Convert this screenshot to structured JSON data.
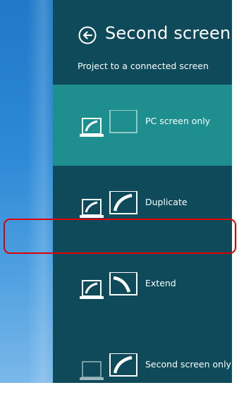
{
  "panel": {
    "title": "Second screen",
    "subtitle": "Project to a connected screen"
  },
  "options": [
    {
      "label": "PC screen only",
      "selected": true,
      "icon": "pc-screen-only-icon"
    },
    {
      "label": "Duplicate",
      "selected": false,
      "icon": "duplicate-icon"
    },
    {
      "label": "Extend",
      "selected": false,
      "icon": "extend-icon"
    },
    {
      "label": "Second screen only",
      "selected": false,
      "icon": "second-screen-only-icon"
    }
  ],
  "colors": {
    "panel_bg": "#0e4a5a",
    "selected_bg": "#1f8e8e",
    "highlight": "#e00000",
    "desktop": "#2d89d6"
  }
}
